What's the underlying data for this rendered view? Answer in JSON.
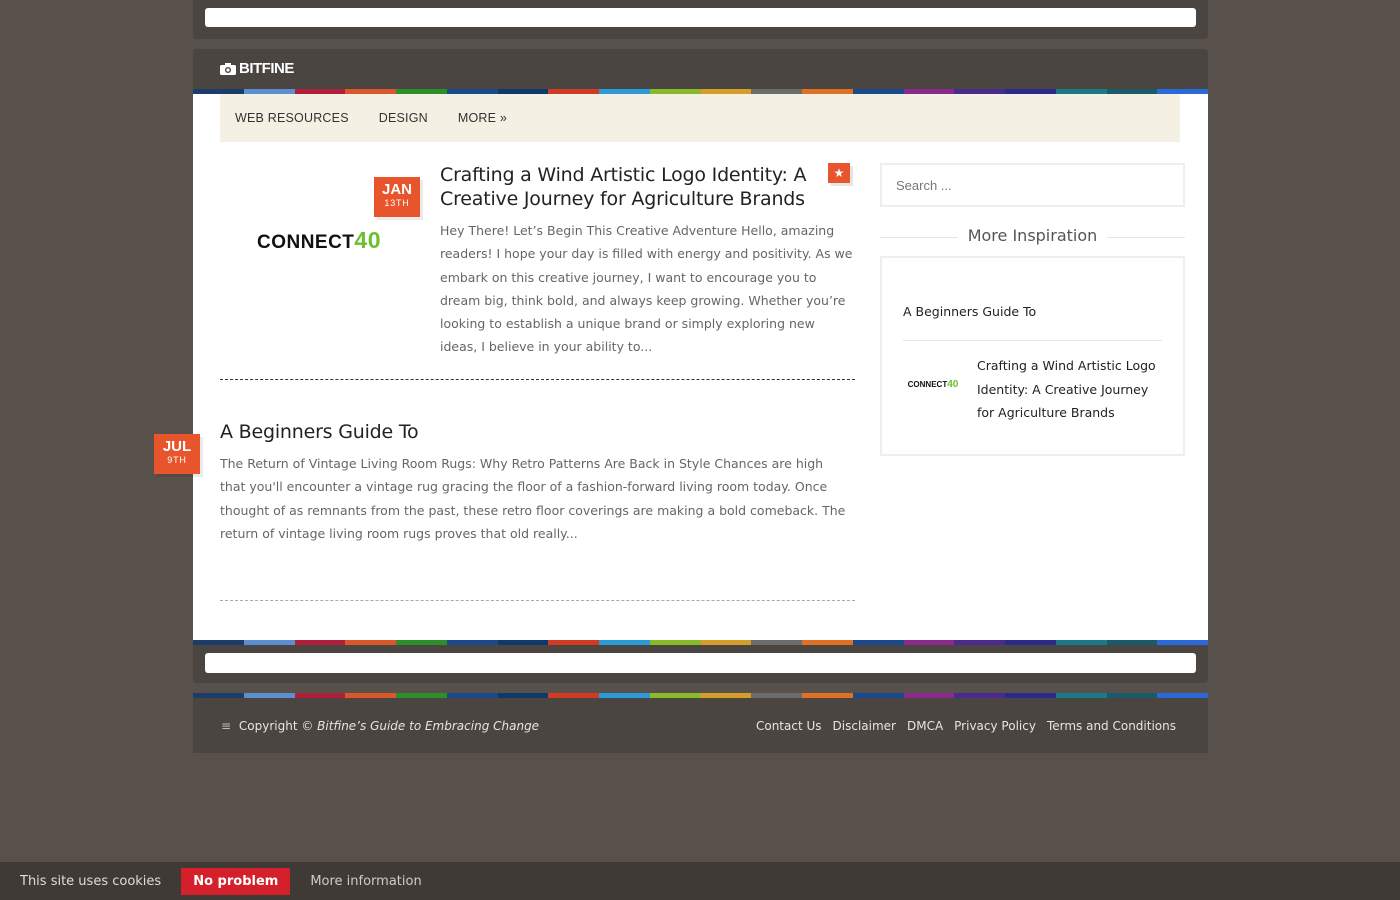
{
  "site": {
    "logo_text": "BITFINE"
  },
  "nav": {
    "items": [
      {
        "label": "WEB RESOURCES"
      },
      {
        "label": "DESIGN"
      },
      {
        "label": "MORE »"
      }
    ]
  },
  "colors": {
    "rainbow": [
      "#1a3d6b",
      "#5b8fd0",
      "#b01e3a",
      "#d9572a",
      "#2c8f2a",
      "#1a4a8c",
      "#0d3a6a",
      "#d13a24",
      "#2a9bd6",
      "#8ab92a",
      "#d59e2a",
      "#6c6c6c",
      "#e07024",
      "#1a4a8c",
      "#8a2a8c",
      "#4a2a8c",
      "#2a2a8c",
      "#1a7a8a",
      "#1a5a6a",
      "#2a6ad8"
    ],
    "accent": "#e8542b"
  },
  "posts": [
    {
      "title": "Crafting a Wind Artistic Logo Identity: A Creative Journey for Agriculture Brands",
      "excerpt": "Hey There! Let’s Begin This Creative Adventure Hello, amazing readers! I hope your day is filled with energy and positivity. As we embark on this creative journey, I want to encourage you to dream big, think bold, and always keep growing. Whether you’re looking to establish a unique brand or simply exploring new ideas, I believe in your ability to...",
      "date_month": "JAN",
      "date_day": "13TH",
      "thumb_text": "CONNECT",
      "thumb_num": "40",
      "sticky_icon": "star-icon"
    },
    {
      "title": "A Beginners Guide To",
      "excerpt": "The Return of Vintage Living Room Rugs: Why Retro Patterns Are Back in Style Chances are high that you'll encounter a vintage rug gracing the floor of a fashion-forward living room today. Once thought of as remnants from the past, these retro floor coverings are making a bold comeback. The return of vintage living room rugs proves that old really...",
      "date_month": "JUL",
      "date_day": "9TH"
    }
  ],
  "sidebar": {
    "search_placeholder": "Search ...",
    "widget_title": "More Inspiration",
    "items": [
      {
        "label": "A Beginners Guide To"
      },
      {
        "label": "Crafting a Wind Artistic Logo Identity: A Creative Journey for Agriculture Brands",
        "thumb_text": "CONNECT",
        "thumb_num": "40"
      }
    ]
  },
  "footer": {
    "copyright_prefix": "Copyright ©",
    "copyright_site": "Bitfine’s Guide to Embracing Change",
    "links": [
      "Contact Us",
      "Disclaimer",
      "DMCA",
      "Privacy Policy",
      "Terms and Conditions"
    ]
  },
  "cookie": {
    "text": "This site uses cookies",
    "button": "No problem",
    "more": "More information"
  }
}
